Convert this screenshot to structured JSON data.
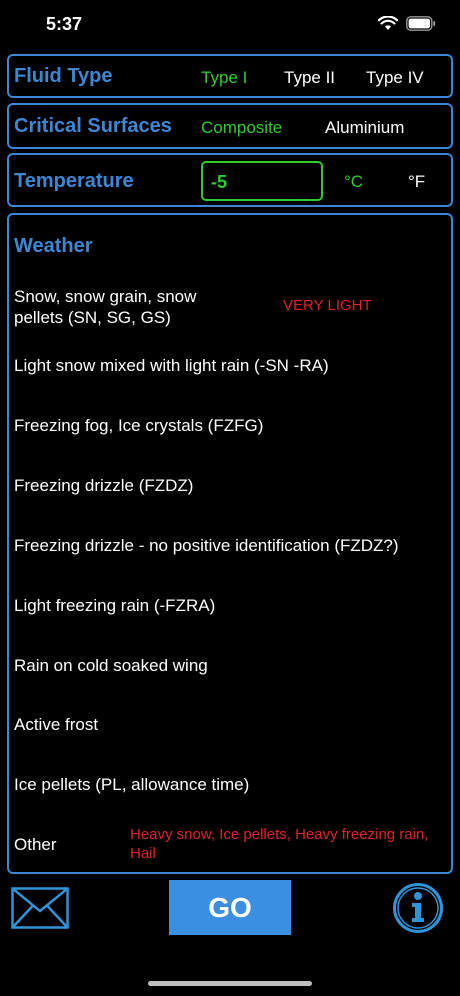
{
  "status": {
    "time": "5:37"
  },
  "fluid": {
    "label": "Fluid Type",
    "options": [
      "Type I",
      "Type II",
      "Type IV"
    ],
    "selected": "Type I"
  },
  "surfaces": {
    "label": "Critical Surfaces",
    "options": [
      "Composite",
      "Aluminium"
    ],
    "selected": "Composite"
  },
  "temperature": {
    "label": "Temperature",
    "value": "-5",
    "units": [
      "°C",
      "°F"
    ],
    "selected_unit": "°C"
  },
  "weather": {
    "label": "Weather",
    "items": [
      {
        "label": "Snow, snow grain, snow pellets (SN, SG, GS)",
        "note": "VERY LIGHT"
      },
      {
        "label": "Light snow mixed with light rain (-SN -RA)"
      },
      {
        "label": "Freezing fog, Ice crystals (FZFG)"
      },
      {
        "label": "Freezing drizzle (FZDZ)"
      },
      {
        "label": "Freezing drizzle - no positive identification (FZDZ?)"
      },
      {
        "label": "Light freezing rain (-FZRA)"
      },
      {
        "label": "Rain on cold soaked wing"
      },
      {
        "label": "Active frost"
      },
      {
        "label": "Ice pellets (PL, allowance time)"
      },
      {
        "label": "Other",
        "note": "Heavy snow, Ice pellets, Heavy freezing rain, Hail"
      }
    ]
  },
  "actions": {
    "go_label": "GO"
  },
  "colors": {
    "accent": "#3c86d4",
    "selected": "#2ecc2e",
    "warning": "#e0222a",
    "button": "#3a8fe0"
  },
  "icons": [
    "wifi-icon",
    "battery-icon",
    "mail-icon",
    "info-icon",
    "signal-icon"
  ]
}
